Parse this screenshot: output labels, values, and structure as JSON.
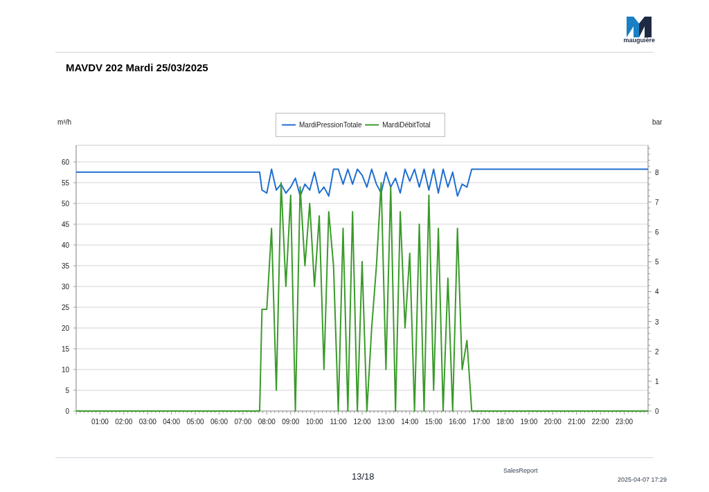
{
  "header": {
    "logo_text": "mauguière"
  },
  "title": "MAVDV 202 Mardi 25/03/2025",
  "chart": {
    "chart_data": {
      "type": "line",
      "grid": "y",
      "legend": "top",
      "ylabel": "m³/h",
      "y2label": "bar",
      "xlim": [
        0,
        24
      ],
      "ylim": [
        0,
        64
      ],
      "y2lim": [
        0,
        8.9
      ],
      "yticks": [
        0,
        5,
        10,
        15,
        20,
        25,
        30,
        35,
        40,
        45,
        50,
        55,
        60
      ],
      "y2ticks": [
        0,
        1,
        2,
        3,
        4,
        5,
        6,
        7,
        8
      ],
      "xticks": [
        {
          "value": 1,
          "label": "01:00"
        },
        {
          "value": 2,
          "label": "02:00"
        },
        {
          "value": 3,
          "label": "03:00"
        },
        {
          "value": 4,
          "label": "04:00"
        },
        {
          "value": 5,
          "label": "05:00"
        },
        {
          "value": 6,
          "label": "06:00"
        },
        {
          "value": 7,
          "label": "07:00"
        },
        {
          "value": 8,
          "label": "08:00"
        },
        {
          "value": 9,
          "label": "09:00"
        },
        {
          "value": 10,
          "label": "10:00"
        },
        {
          "value": 11,
          "label": "11:00"
        },
        {
          "value": 12,
          "label": "12:00"
        },
        {
          "value": 13,
          "label": "13:00"
        },
        {
          "value": 14,
          "label": "14:00"
        },
        {
          "value": 15,
          "label": "15:00"
        },
        {
          "value": 16,
          "label": "16:00"
        },
        {
          "value": 17,
          "label": "17:00"
        },
        {
          "value": 18,
          "label": "18:00"
        },
        {
          "value": 19,
          "label": "19:00"
        },
        {
          "value": 20,
          "label": "20:00"
        },
        {
          "value": 21,
          "label": "21:00"
        },
        {
          "value": 22,
          "label": "22:00"
        },
        {
          "value": 23,
          "label": "23:00"
        }
      ],
      "x": [
        0,
        7.7,
        7.8,
        8.0,
        8.2,
        8.4,
        8.6,
        8.8,
        9.0,
        9.2,
        9.4,
        9.6,
        9.8,
        10.0,
        10.2,
        10.4,
        10.6,
        10.8,
        11.0,
        11.2,
        11.4,
        11.6,
        11.8,
        12.0,
        12.2,
        12.4,
        12.6,
        12.8,
        13.0,
        13.2,
        13.4,
        13.6,
        13.8,
        14.0,
        14.2,
        14.4,
        14.6,
        14.8,
        15.0,
        15.2,
        15.4,
        15.6,
        15.8,
        16.0,
        16.2,
        16.4,
        16.6,
        24
      ],
      "series": [
        {
          "name": "MardiPressionTotale",
          "color": "#1f6fd0",
          "axis": "y2",
          "values": [
            8.0,
            8.0,
            7.4,
            7.3,
            8.1,
            7.4,
            7.6,
            7.3,
            7.5,
            7.8,
            7.2,
            7.6,
            7.4,
            8.0,
            7.3,
            7.5,
            7.2,
            8.1,
            8.1,
            7.6,
            8.1,
            7.6,
            8.1,
            7.9,
            7.5,
            8.1,
            7.6,
            7.3,
            8.0,
            7.5,
            7.8,
            7.3,
            8.1,
            7.7,
            8.1,
            7.5,
            8.1,
            7.4,
            8.1,
            7.3,
            8.1,
            7.5,
            8.0,
            7.2,
            7.6,
            7.5,
            8.1,
            8.1
          ]
        },
        {
          "name": "MardiDébitTotal",
          "color": "#3a9a2a",
          "axis": "y",
          "values": [
            0,
            0,
            24.5,
            24.5,
            44,
            5,
            55,
            30,
            52,
            0,
            54,
            35,
            50,
            30,
            47,
            10,
            48,
            35,
            0,
            44,
            0,
            48,
            0,
            36,
            0,
            20,
            35,
            55,
            10,
            54,
            0,
            48,
            20,
            38,
            0,
            45,
            0,
            52,
            5,
            44,
            0,
            32,
            0,
            44,
            10,
            17,
            0,
            0
          ]
        }
      ]
    }
  },
  "footer": {
    "page": "13/18",
    "report_name": "SalesReport",
    "timestamp": "2025-04-07 17:29"
  }
}
